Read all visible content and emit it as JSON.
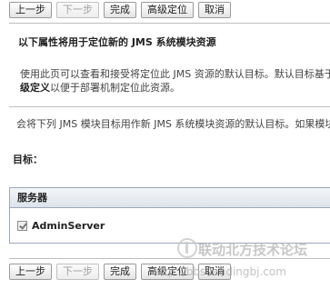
{
  "toolbar_top": {
    "prev": "上一步",
    "next": "下一步",
    "finish": "完成",
    "advanced": "高级定位",
    "cancel": "取消"
  },
  "section": {
    "heading": "以下属性将用于定位新的 JMS 系统模块资源",
    "desc_line1": "使用此页可以查看和接受将定位此 JMS 资源的默认目标。默认目标基于",
    "desc_line2_bold": "级定义",
    "desc_line2_rest": "以便于部署机制定位此资源。",
    "info": "会将下列 JMS 模块目标用作新 JMS 系统模块资源的默认目标。如果模块"
  },
  "targets": {
    "label": "目标：",
    "column_header": "服务器",
    "rows": [
      {
        "name": "AdminServer",
        "checked": true
      }
    ]
  },
  "toolbar_bottom": {
    "prev": "上一步",
    "next": "下一步",
    "finish": "完成",
    "advanced": "高级定位",
    "cancel": "取消"
  },
  "watermark": {
    "title": "联动北方技术论坛",
    "url": "http://bbs.landingbj.com"
  }
}
